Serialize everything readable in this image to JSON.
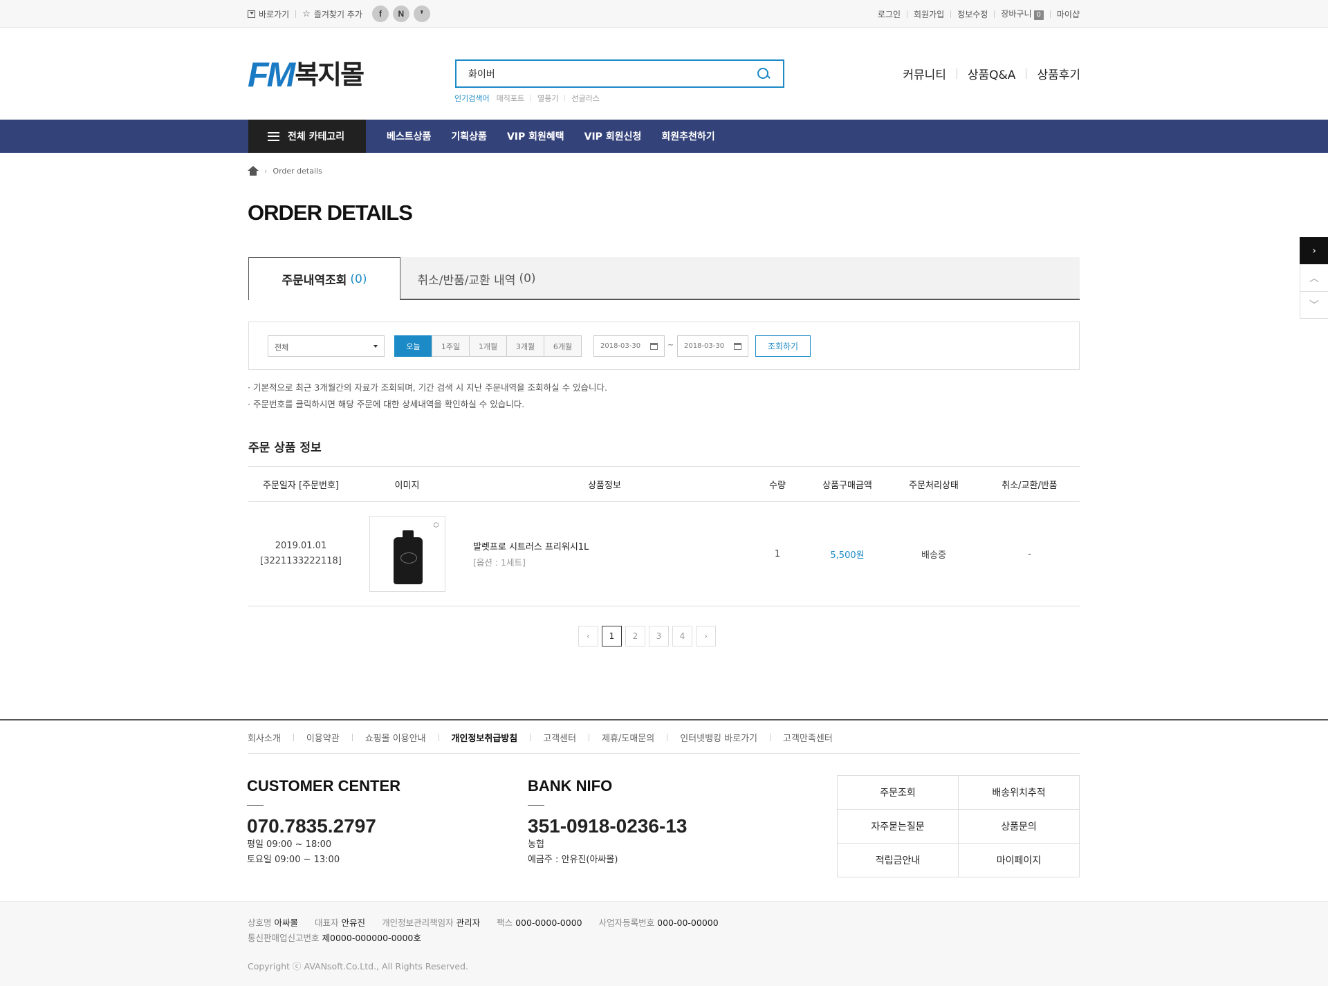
{
  "topbar": {
    "shortcut": "바로가기",
    "bookmark": "즐겨찾기 추가",
    "sns": [
      "f",
      "N",
      "❜"
    ],
    "login": "로그인",
    "join": "회원가입",
    "edit_info": "정보수정",
    "cart": "장바구니",
    "cart_count": "0",
    "myshop": "마이샵"
  },
  "header": {
    "logo_en": "FM",
    "logo_kr": "복지몰",
    "search_value": "화이버",
    "popular_label": "인기검색어",
    "popular_terms": [
      "매직포트",
      "열풍기",
      "선글라스"
    ],
    "links": [
      "커뮤니티",
      "상품Q&A",
      "상품후기"
    ]
  },
  "gnb": {
    "all_category": "전체 카테고리",
    "menu": [
      "베스트상품",
      "기획상품",
      "VIP 회원혜택",
      "VIP 회원신청",
      "회원추천하기"
    ]
  },
  "breadcrumb": {
    "current": "Order details"
  },
  "page_title": "ORDER DETAILS",
  "tabs": [
    {
      "label": "주문내역조회",
      "count": "(0)"
    },
    {
      "label": "취소/반품/교환 내역",
      "count": "(0)"
    }
  ],
  "filter": {
    "select_value": "전체",
    "periods": [
      "오늘",
      "1주일",
      "1개월",
      "3개월",
      "6개월"
    ],
    "date_from": "2018-03-30",
    "date_to": "2018-03-30",
    "tilde": "~",
    "search_button": "조회하기"
  },
  "notes": [
    "· 기본적으로 최근 3개월간의 자료가 조회되며, 기간 검색 시 지난 주문내역을 조회하실 수 있습니다.",
    "· 주문번호를 클릭하시면 해당 주문에 대한 상세내역을 확인하실 수 있습니다."
  ],
  "section_title": "주문 상품 정보",
  "table": {
    "headers": [
      "주문일자 [주문번호]",
      "이미지",
      "상품정보",
      "수량",
      "상품구매금액",
      "주문처리상태",
      "취소/교환/반품"
    ],
    "rows": [
      {
        "date": "2019.01.01",
        "order_no": "[3221133222118]",
        "name": "발렛프로 시트러스 프리워시1L",
        "option": "[옵션 : 1세트]",
        "qty": "1",
        "price": "5,500원",
        "status": "배송중",
        "cancel": "-"
      }
    ]
  },
  "pagination": {
    "prev": "‹",
    "pages": [
      "1",
      "2",
      "3",
      "4"
    ],
    "next": "›"
  },
  "side_quick": [
    "›",
    "︿",
    "﹀"
  ],
  "footer": {
    "nav": [
      "회사소개",
      "이용약관",
      "쇼핑몰 이용안내",
      "개인정보취급방침",
      "고객센터",
      "제휴/도매문의",
      "인터넷뱅킹 바로가기",
      "고객만족센터"
    ],
    "customer": {
      "title": "CUSTOMER CENTER",
      "phone": "070.7835.2797",
      "hours1": "평일 09:00 ~ 18:00",
      "hours2": "토요일 09:00 ~ 13:00"
    },
    "bank": {
      "title": "BANK NIFO",
      "account": "351-0918-0236-13",
      "bank_name": "농협",
      "holder": "예금주 : 안유진(아싸몰)"
    },
    "quick": [
      [
        "주문조회",
        "배송위치추적"
      ],
      [
        "자주묻는질문",
        "상품문의"
      ],
      [
        "적립금안내",
        "마이페이지"
      ]
    ],
    "info": {
      "company_label": "상호명",
      "company": "아싸몰",
      "ceo_label": "대표자",
      "ceo": "안유진",
      "privacy_label": "개인정보관리책임자",
      "privacy": "관리자",
      "fax_label": "팩스",
      "fax": "000-0000-0000",
      "bizno_label": "사업자등록번호",
      "bizno": "000-00-00000",
      "telsales_label": "통신판매업신고번호",
      "telsales": "제0000-000000-0000호"
    },
    "copyright": "Copyright ⓒ AVANsoft.Co.Ltd., All Rights Reserved."
  }
}
